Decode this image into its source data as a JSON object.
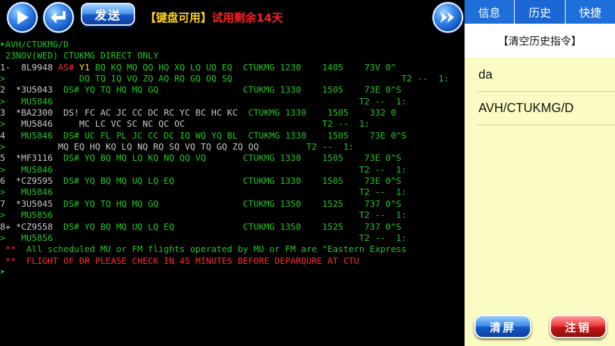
{
  "toolbar": {
    "play_icon": "play-icon",
    "return_icon": "return-icon",
    "send_label": "发送",
    "keyboard_status": "【键盘可用】",
    "trial_status": "试用剩余14天",
    "forward_icon": "fast-forward-icon"
  },
  "terminal": {
    "prompt1_cmd": "AVH/CTUKMG/D",
    "header": " 23NOV(WED) CTUKMG DIRECT ONLY",
    "rows": [
      {
        "a": "1-  8L9948 ",
        "b": "AS#",
        "c": " ",
        "d": "Y1",
        "e": " BQ KQ MQ QQ HQ XQ LQ UQ EQ  ",
        "f": "CTUKMG 1230    1405    73V 0^"
      },
      {
        "a": ">          ",
        "b": "",
        "c": "    ",
        "d": "",
        "e": "DQ TQ IQ VQ ZQ AQ RQ GQ OQ SQ",
        "f": "                                T2 --  1:"
      },
      {
        "a": "2  *3U5043  ",
        "b": "DS#",
        "c": " YQ TQ HQ MQ GQ                ",
        "d": "",
        "e": "",
        "f": "CTUKMG 1330    1505    73E 0^S"
      },
      {
        "a": ">   ",
        "b": "",
        "c": "MU5846",
        "d": "",
        "e": "",
        "f": "                                                          T2 --  1:"
      },
      {
        "a": "3  *BA2300  ",
        "b": "DS!",
        "c": " FC AC JC CC DC RC YC BC HC KC  ",
        "d": "",
        "e": "",
        "f": "CTUKMG 1330    1505    332 0"
      },
      {
        "a": ">   ",
        "b": "",
        "c": "MU5846     MC LC VC SC NC QC OC",
        "d": "",
        "e": "",
        "f": "                          T2 --  1:"
      },
      {
        "a": "4   ",
        "b": "",
        "c": "MU5846  DS# UC FL PL JC CC DC IQ WQ YQ BL  ",
        "d": "",
        "e": "",
        "f": "CTUKMG 1330    1505    73E 0^S"
      },
      {
        "a": ">          ",
        "b": "",
        "c": "MQ EQ HQ KQ LQ NQ RQ SQ VQ TQ GQ ZQ QQ",
        "d": "",
        "e": "",
        "f": "         T2 --  1:"
      },
      {
        "a": "5  *MF3116  ",
        "b": "DS#",
        "c": " YQ BQ MQ LQ KQ NQ QQ VQ       ",
        "d": "",
        "e": "",
        "f": "CTUKMG 1330    1505    73E 0^S"
      },
      {
        "a": ">   ",
        "b": "",
        "c": "MU5846",
        "d": "",
        "e": "",
        "f": "                                                          T2 --  1:"
      },
      {
        "a": "6  *CZ9595  ",
        "b": "DS#",
        "c": " YQ BQ MQ UQ LQ EQ             ",
        "d": "",
        "e": "",
        "f": "CTUKMG 1330    1505    73E 0^S"
      },
      {
        "a": ">   ",
        "b": "",
        "c": "MU5846",
        "d": "",
        "e": "",
        "f": "                                                          T2 --  1:"
      },
      {
        "a": "7  *3U5045  ",
        "b": "DS#",
        "c": " YQ TQ HQ MQ GQ                ",
        "d": "",
        "e": "",
        "f": "CTUKMG 1350    1525    737 0^S"
      },
      {
        "a": ">   ",
        "b": "",
        "c": "MU5856",
        "d": "",
        "e": "",
        "f": "                                                          T2 --  1:"
      },
      {
        "a": "8+ *CZ9558  ",
        "b": "DS#",
        "c": " YQ BQ MQ UQ LQ EQ             ",
        "d": "",
        "e": "",
        "f": "CTUKMG 1350    1525    737 0^S"
      },
      {
        "a": ">   ",
        "b": "",
        "c": "MU5856",
        "d": "",
        "e": "",
        "f": "                                                          T2 --  1:"
      }
    ],
    "note1_mark": " **",
    "note1_text": "  All scheduled MU or FM flights operated by MU or FM are \"Eastern Express",
    "note2_mark": " **",
    "note2_text": "  FLIGHT OF DR PLEASE CHECK IN 45 MINUTES BEFORE DEPARQURE AT CTU",
    "prompt_icon": "green-arrow-icon"
  },
  "panel": {
    "tabs": [
      {
        "label": "信息"
      },
      {
        "label": "历史"
      },
      {
        "label": "快捷"
      }
    ],
    "clear_history": "【清空历史指令】",
    "history": [
      "da",
      "AVH/CTUKMG/D"
    ],
    "clear_screen": "清屏",
    "logout": "注销"
  },
  "colors": {
    "terminal_green": "#1fc81f",
    "terminal_red": "#ff2a2a",
    "tab_blue": "#1e6fd9",
    "panel_bg": "#fbfbc4"
  }
}
